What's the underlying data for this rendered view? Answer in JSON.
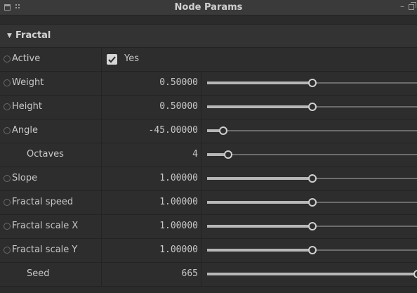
{
  "window": {
    "title": "Node Params"
  },
  "section": {
    "label": "Fractal",
    "collapse_icon": "triangle-down-icon"
  },
  "active": {
    "label": "Active",
    "checked": true,
    "value_label": "Yes"
  },
  "params": [
    {
      "label": "Weight",
      "value": "0.50000",
      "slider": 0.5,
      "radio": true
    },
    {
      "label": "Height",
      "value": "0.50000",
      "slider": 0.5,
      "radio": true
    },
    {
      "label": "Angle",
      "value": "-45.00000",
      "slider": 0.075,
      "radio": true
    },
    {
      "label": "Octaves",
      "value": "4",
      "slider": 0.1,
      "radio": false
    },
    {
      "label": "Slope",
      "value": "1.00000",
      "slider": 0.5,
      "radio": true
    },
    {
      "label": "Fractal speed",
      "value": "1.00000",
      "slider": 0.5,
      "radio": true
    },
    {
      "label": "Fractal scale X",
      "value": "1.00000",
      "slider": 0.5,
      "radio": true
    },
    {
      "label": "Fractal scale Y",
      "value": "1.00000",
      "slider": 0.5,
      "radio": true
    },
    {
      "label": "Seed",
      "value": "665",
      "slider": 1.0,
      "radio": false
    }
  ]
}
